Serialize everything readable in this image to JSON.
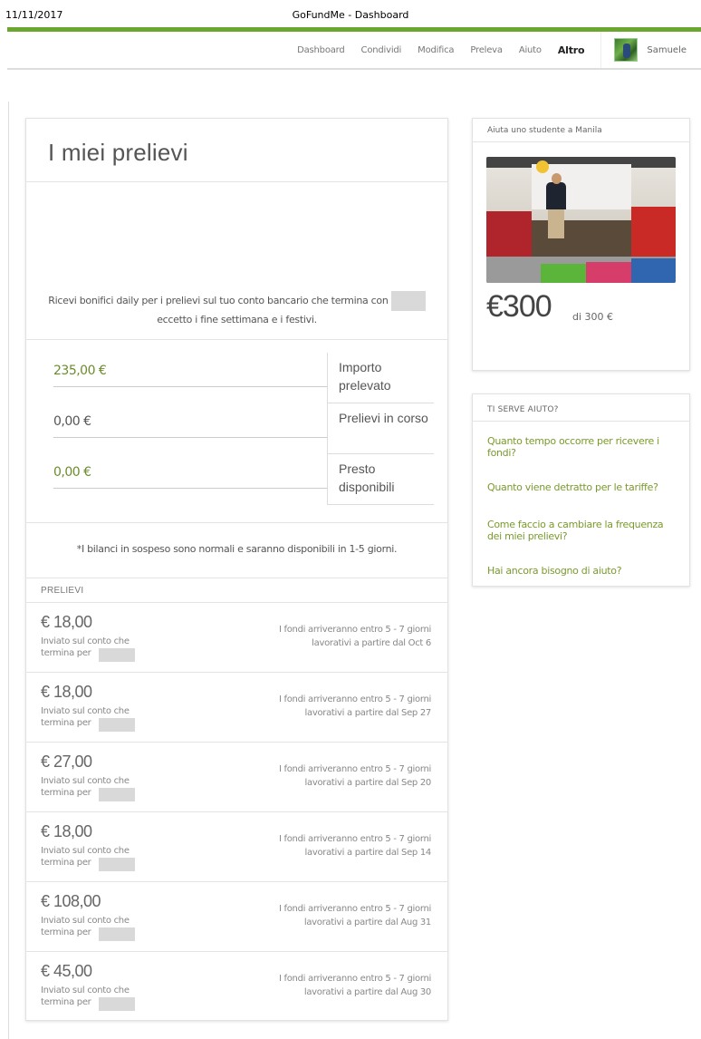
{
  "print": {
    "date": "11/11/2017",
    "title": "GoFundMe - Dashboard"
  },
  "nav": {
    "items": [
      "Dashboard",
      "Condividi",
      "Modifica",
      "Preleva",
      "Aiuto"
    ],
    "active": "Altro",
    "user": "Samuele"
  },
  "main": {
    "title": "I miei prelievi",
    "info_line1": "Ricevi bonifici daily per i prelievi sul tuo conto bancario che termina con",
    "info_line2": "eccetto i fine settimana e i festivi.",
    "balances": [
      {
        "value": "235,00 €",
        "label": "Importo prelevato",
        "color": "#6c8c2c"
      },
      {
        "value": "0,00 €",
        "label": "Prelievi in corso",
        "color": "#555555"
      },
      {
        "value": "0,00 €",
        "label": "Presto disponibili",
        "color": "#6c8c2c"
      }
    ],
    "pending_note": "*I bilanci in sospeso sono normali e saranno disponibili in 1-5 giorni.",
    "withdrawals_header": "PRELIEVI",
    "withdrawals": [
      {
        "amount": "€ 18,00",
        "sent": "Inviato sul conto che termina per",
        "status_line1": "I fondi arriveranno entro 5 - 7 giorni",
        "status_line2": "lavorativi a partire dal Oct 6"
      },
      {
        "amount": "€ 18,00",
        "sent": "Inviato sul conto che termina per",
        "status_line1": "I fondi arriveranno entro 5 - 7 giorni",
        "status_line2": "lavorativi a partire dal Sep 27"
      },
      {
        "amount": "€ 27,00",
        "sent": "Inviato sul conto che termina per",
        "status_line1": "I fondi arriveranno entro 5 - 7 giorni",
        "status_line2": "lavorativi a partire dal Sep 20"
      },
      {
        "amount": "€ 18,00",
        "sent": "Inviato sul conto che termina per",
        "status_line1": "I fondi arriveranno entro 5 - 7 giorni",
        "status_line2": "lavorativi a partire dal Sep 14"
      },
      {
        "amount": "€ 108,00",
        "sent": "Inviato sul conto che termina per",
        "status_line1": "I fondi arriveranno entro 5 - 7 giorni",
        "status_line2": "lavorativi a partire dal Aug 31"
      },
      {
        "amount": "€ 45,00",
        "sent": "Inviato sul conto che termina per",
        "status_line1": "I fondi arriveranno entro 5 - 7 giorni",
        "status_line2": "lavorativi a partire dal Aug 30"
      }
    ]
  },
  "campaign": {
    "name": "Aiuta uno studente a Manila",
    "raised": "€300",
    "goal": "di 300 €"
  },
  "help": {
    "header": "TI SERVE AIUTO?",
    "links": [
      "Quanto tempo occorre per ricevere i fondi?",
      "Quanto viene detratto per le tariffe?",
      "Come faccio a cambiare la frequenza dei miei prelievi?",
      "Hai ancora bisogno di aiuto?"
    ]
  },
  "colors": {
    "brand_green": "#6ba62f",
    "link_green": "#7a9a2c"
  }
}
